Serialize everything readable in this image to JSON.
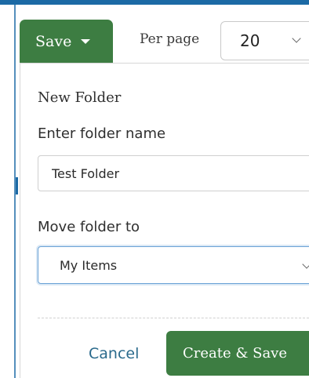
{
  "toolbar": {
    "save_label": "Save",
    "per_page_label": "Per page",
    "per_page_value": "20"
  },
  "new_folder": {
    "title": "New Folder",
    "name_label": "Enter folder name",
    "name_value": "Test Folder",
    "move_label": "Move folder to",
    "move_value": "My Items",
    "cancel_label": "Cancel",
    "create_label": "Create & Save"
  },
  "colors": {
    "primary_green": "#3d7d42",
    "link_blue": "#2a6a8c",
    "focus_blue": "#6ba3d6",
    "frame_blue": "#1c6aa5"
  },
  "icons": {
    "save_caret": "caret-down-icon",
    "per_page_chevron": "chevron-down-icon",
    "folder_chevron": "chevron-down-icon"
  }
}
